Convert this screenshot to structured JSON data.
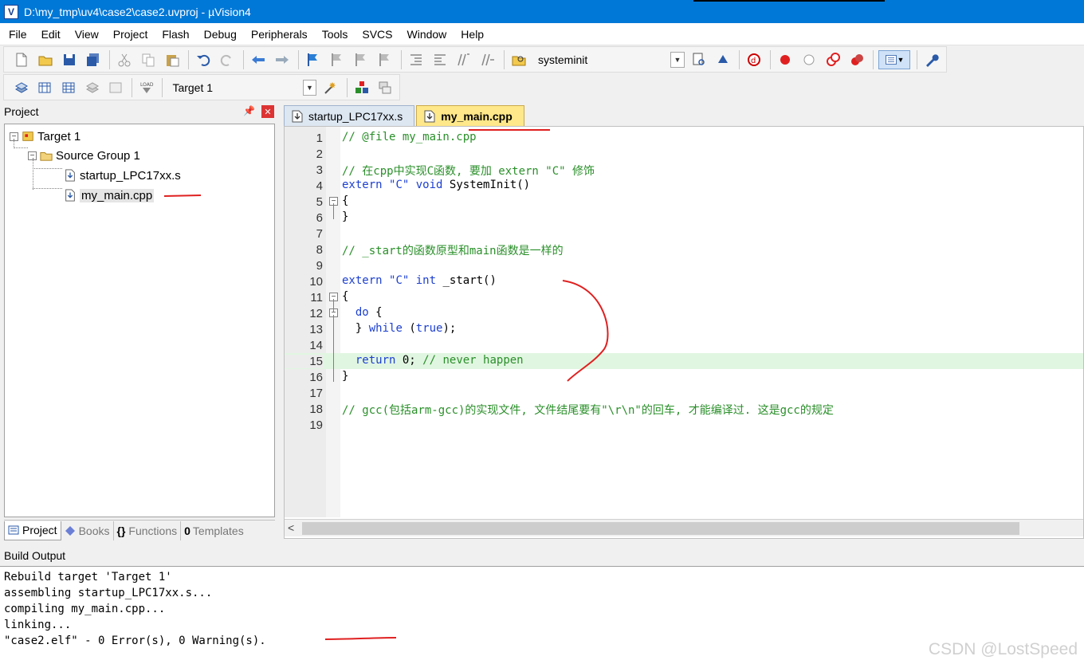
{
  "window": {
    "title": "D:\\my_tmp\\uv4\\case2\\case2.uvproj - µVision4"
  },
  "menu": [
    "File",
    "Edit",
    "View",
    "Project",
    "Flash",
    "Debug",
    "Peripherals",
    "Tools",
    "SVCS",
    "Window",
    "Help"
  ],
  "toolbar": {
    "find_combo_value": "systeminit",
    "target_combo_value": "Target 1"
  },
  "project": {
    "title": "Project",
    "tree": {
      "root": "Target 1",
      "group": "Source Group 1",
      "files": [
        "startup_LPC17xx.s",
        "my_main.cpp"
      ]
    },
    "tabs": [
      "Project",
      "Books",
      "Functions",
      "Templates"
    ]
  },
  "editor": {
    "tabs": [
      "startup_LPC17xx.s",
      "my_main.cpp"
    ],
    "active_tab": "my_main.cpp",
    "line_numbers": [
      "1",
      "2",
      "3",
      "4",
      "5",
      "6",
      "7",
      "8",
      "9",
      "10",
      "11",
      "12",
      "13",
      "14",
      "15",
      "16",
      "17",
      "18",
      "19"
    ],
    "code": {
      "l1": "// @file my_main.cpp",
      "l3": "// 在cpp中实现C函数, 要加 extern \"C\" 修饰",
      "l4_kw": "extern",
      "l4_str": "\"C\"",
      "l4_kw2": "void",
      "l4_rest": "SystemInit()",
      "l5": "{",
      "l6": "}",
      "l8": "// _start的函数原型和main函数是一样的",
      "l10_kw": "extern",
      "l10_str": "\"C\"",
      "l10_kw2": "int",
      "l10_rest": "_start()",
      "l11": "{",
      "l12_kw": "do",
      "l12_rest": "{",
      "l13_a": "}",
      "l13_kw": "while",
      "l13_b": "(",
      "l13_kw2": "true",
      "l13_c": ");",
      "l15_kw": "return",
      "l15_num": "0;",
      "l15_cm": "// never happen",
      "l16": "}",
      "l18": "// gcc(包括arm-gcc)的实现文件, 文件结尾要有\"\\r\\n\"的回车, 才能编译过. 这是gcc的规定"
    }
  },
  "build": {
    "title": "Build Output",
    "lines": [
      "Rebuild target 'Target 1'",
      "assembling startup_LPC17xx.s...",
      "compiling my_main.cpp...",
      "linking...",
      "\"case2.elf\" - 0 Error(s), 0 Warning(s)."
    ]
  },
  "watermark": "CSDN @LostSpeed",
  "colors": {
    "titlebar": "#0078d7",
    "comment": "#2a8f2a",
    "keyword": "#1c3fd0",
    "annotation": "#e02020",
    "active_tab": "#ffe889"
  }
}
